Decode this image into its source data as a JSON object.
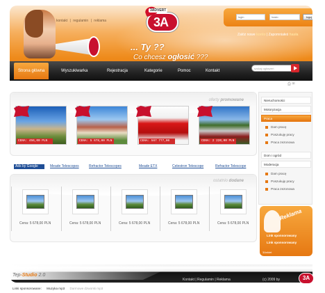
{
  "header": {
    "top_links": [
      "kontakt",
      "|",
      "regulamin",
      "|",
      "reklama"
    ],
    "logo_small": "3ADVERT",
    "logo_big": "3A",
    "login_placeholder": "login",
    "password_placeholder": "hasło",
    "login_button": "loguj",
    "register_text": "Załóż nowe ",
    "register_link": "konto",
    "register_sep": " | ",
    "forgot_text": "Zapomniałeś ",
    "forgot_link": "hasła",
    "slogan_line1": "... Ty ??",
    "slogan_line2_a": "Co chcesz ",
    "slogan_line2_b": "ogłosić",
    "slogan_line2_c": " ???"
  },
  "nav": {
    "items": [
      "Strona główna",
      "Wyszukiwarka",
      "Rejestracja",
      "Kategorie",
      "Pomoc",
      "Kontakt"
    ],
    "search_placeholder": "szukaj ogłoszeń"
  },
  "promoted": {
    "title_a": "oferty ",
    "title_b": "promowane",
    "items": [
      {
        "price": "CENA: 456,00 PLN"
      },
      {
        "price": "CENA: 5 678,00 PLN"
      },
      {
        "price": "CENA: 567 777,00 PLN"
      },
      {
        "price": "CENA: 2 220,00 PLN"
      }
    ]
  },
  "ads": {
    "label": "Ads by Google",
    "links": [
      "Meade Telescopes",
      "Refractor Telescopes",
      "Meade ETX",
      "Celestron Telescope",
      "Refractor Telescope"
    ]
  },
  "recent": {
    "title_a": "ostatnio ",
    "title_b": "dodane",
    "items": [
      {
        "price": "Cena: 5 678,00 PLN"
      },
      {
        "price": "Cena: 5 678,00 PLN"
      },
      {
        "price": "Cena: 5 678,00 PLN"
      },
      {
        "price": "Cena: 5 678,00 PLN"
      },
      {
        "price": "Cena: 5 678,00 PLN"
      }
    ]
  },
  "sidebar": {
    "categories": [
      "Nieruchomości",
      "Motoryzacja",
      "Praca",
      "Dom i ogród",
      "Moderacja"
    ],
    "praca_sub": [
      "Dam pracę",
      "Poszukuję pracy",
      "Praca zezonowa"
    ],
    "moderacja_sub": [
      "Dam pracę",
      "Poszukuję pracy",
      "Praca zezonowa"
    ],
    "promo_text": "Reklama",
    "promo_link1": "Link sponsorowany",
    "promo_link2": "Link sponsorowany",
    "promo_tag": "3Ankiet"
  },
  "footer": {
    "logo_a": "Tep",
    "logo_b": "-Studio",
    "logo_c": " 2.0",
    "links": "Kontakt | Regulamin | Reklama",
    "copyright": "(c) 2009 by",
    "badge": "3A",
    "bottom_label": "Linki sponsorowane:",
    "bottom_link1": "Muzyka mp3",
    "bottom_link2": "Darmowe dzwonki mp3"
  }
}
